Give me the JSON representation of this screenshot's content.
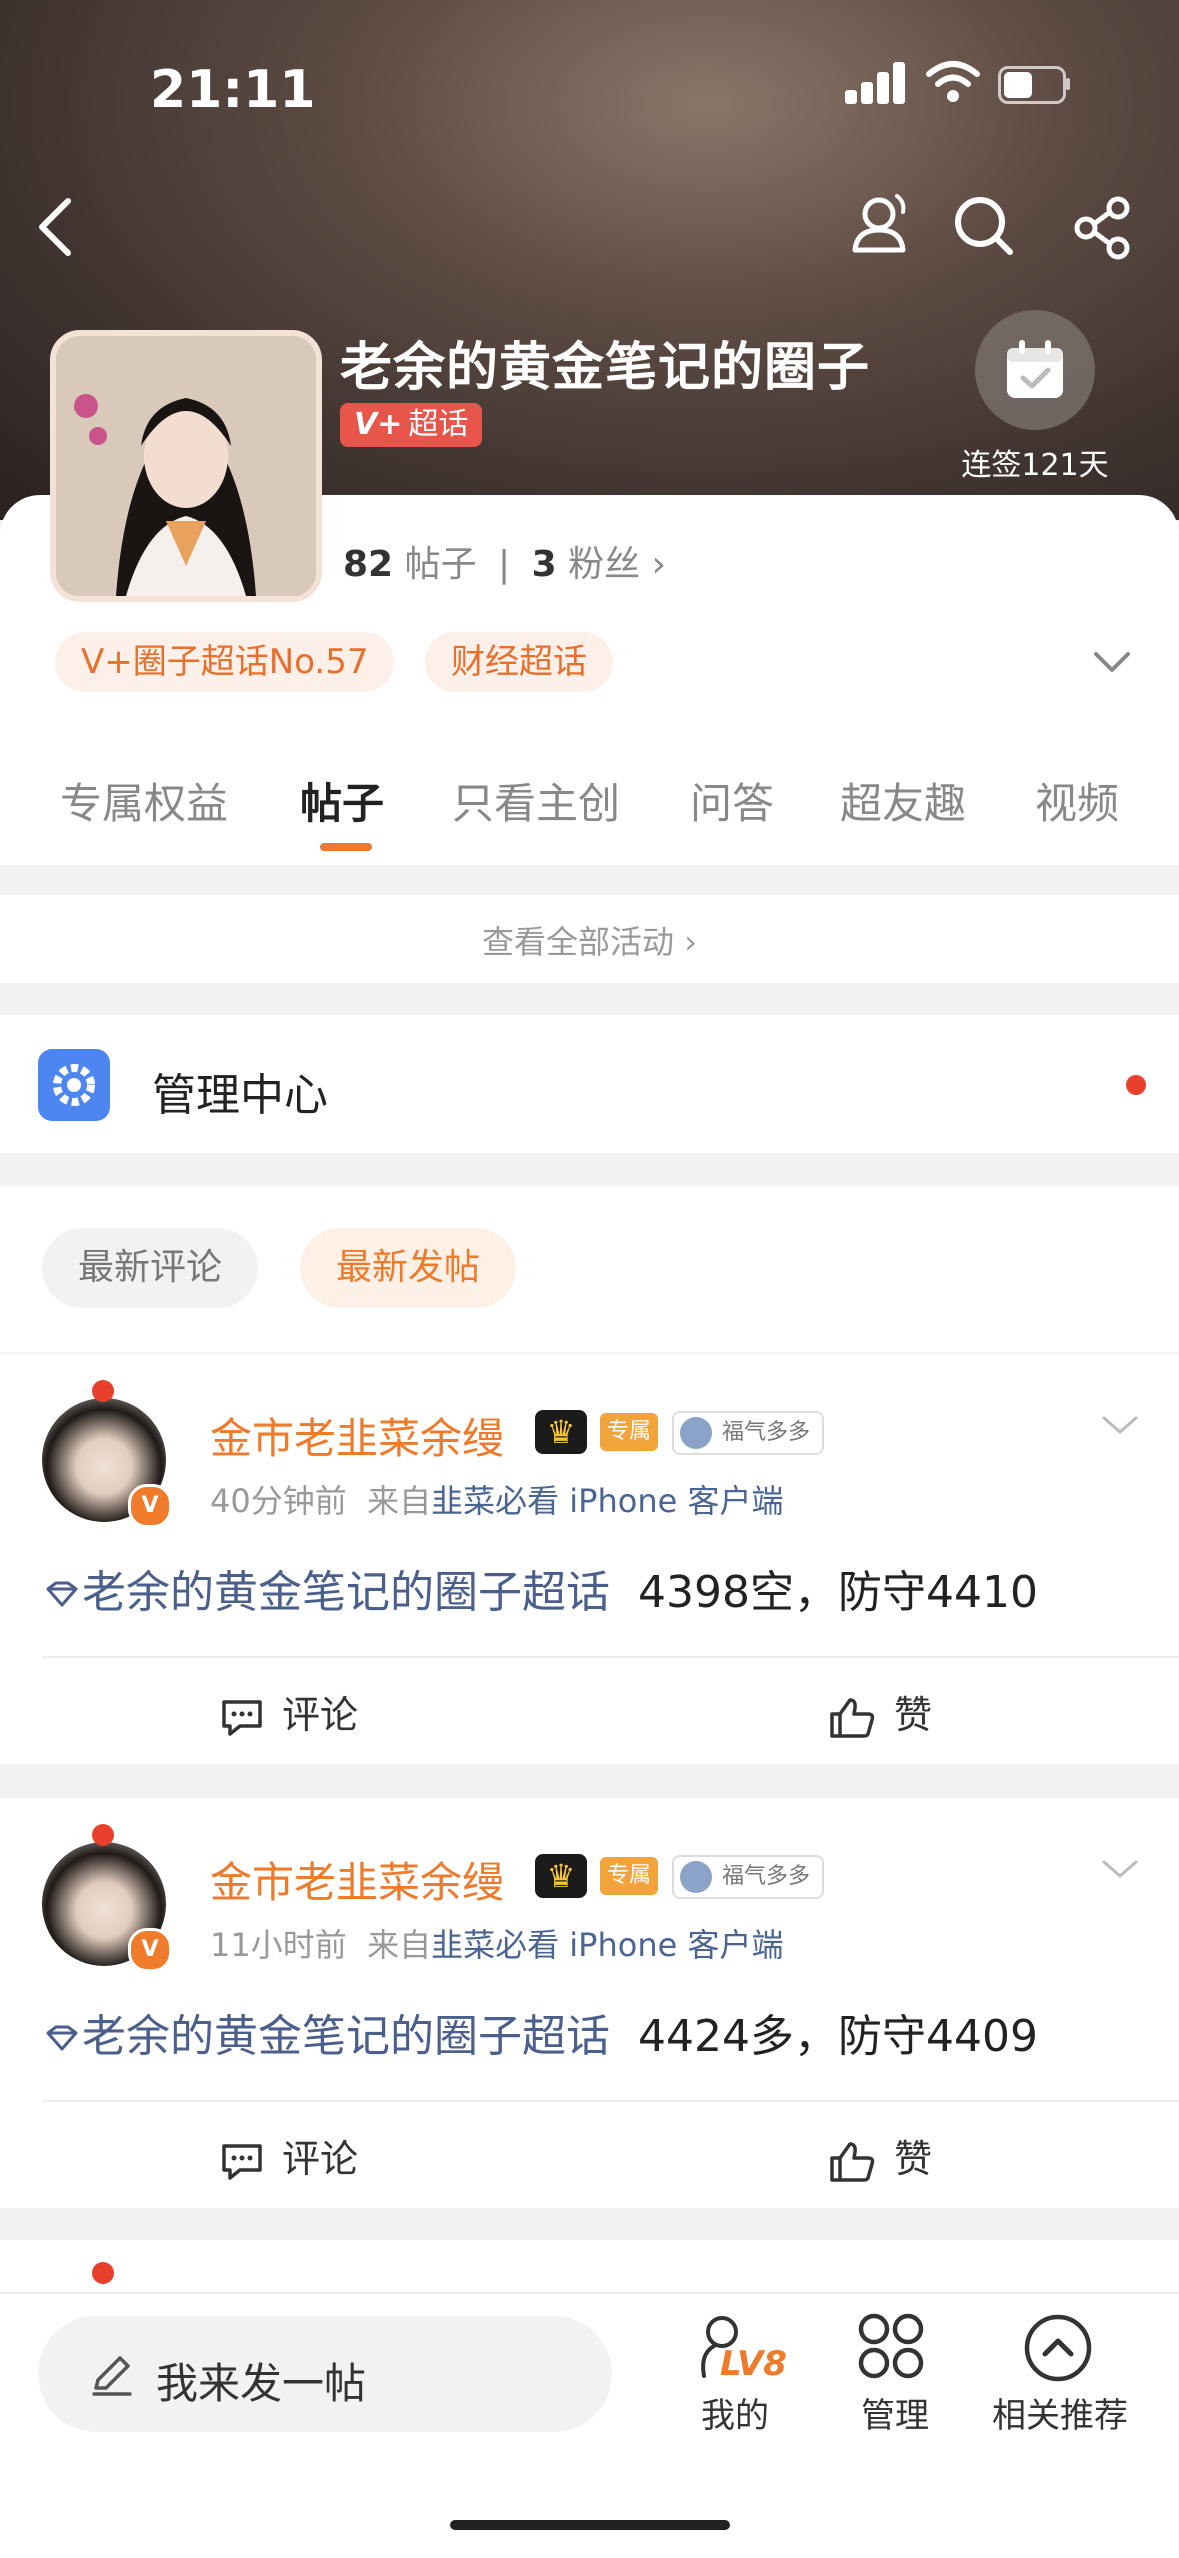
{
  "status_bar": {
    "time": "21:11"
  },
  "circle": {
    "title": "老余的黄金笔记的圈子",
    "badge": "超话",
    "badge_prefix": "V+",
    "sign_in_label": "连签121天",
    "posts_count": "82",
    "posts_label": "帖子",
    "fans_count": "3",
    "fans_label": "粉丝",
    "tags": [
      "V+圈子超话No.57",
      "财经超话"
    ]
  },
  "tabs": [
    "专属权益",
    "帖子",
    "只看主创",
    "问答",
    "超友趣",
    "视频"
  ],
  "active_tab": "帖子",
  "activity_link": "查看全部活动",
  "manage_center": "管理中心",
  "filters": [
    "最新评论",
    "最新发帖"
  ],
  "active_filter": "最新发帖",
  "posts": [
    {
      "username": "金市老韭菜余缦",
      "badge_label": "专属",
      "fortune_label": "福气多多",
      "time": "40分钟前",
      "source_prefix": "来自",
      "source": "韭菜必看 iPhone 客户端",
      "topic": "老余的黄金笔记的圈子超话",
      "text": "4398空，防守4410",
      "comment_label": "评论",
      "like_label": "赞"
    },
    {
      "username": "金市老韭菜余缦",
      "badge_label": "专属",
      "fortune_label": "福气多多",
      "time": "11小时前",
      "source_prefix": "来自",
      "source": "韭菜必看 iPhone 客户端",
      "topic": "老余的黄金笔记的圈子超话",
      "text": "4424多，防守4409",
      "comment_label": "评论",
      "like_label": "赞"
    }
  ],
  "bottom_bar": {
    "compose_placeholder": "我来发一帖",
    "level": "LV8",
    "nav": [
      "我的",
      "管理",
      "相关推荐"
    ]
  },
  "colors": {
    "accent": "#ef7a2e",
    "topic": "#4b5f8c",
    "vbadge": "#e8554a"
  }
}
